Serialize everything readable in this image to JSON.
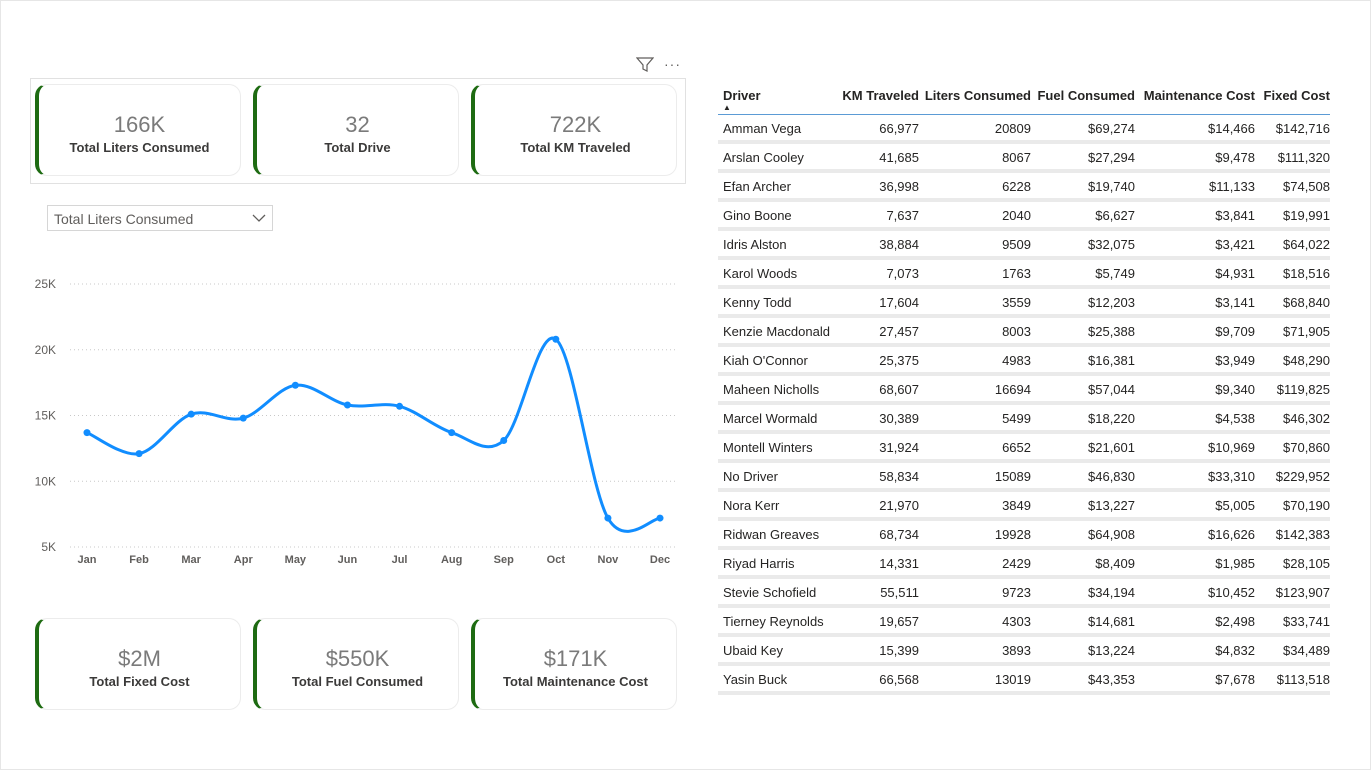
{
  "kpis_top": [
    {
      "value": "166K",
      "label": "Total Liters Consumed"
    },
    {
      "value": "32",
      "label": "Total Drive"
    },
    {
      "value": "722K",
      "label": "Total KM Traveled"
    }
  ],
  "kpis_bottom": [
    {
      "value": "$2M",
      "label": "Total Fixed Cost"
    },
    {
      "value": "$550K",
      "label": "Total Fuel Consumed"
    },
    {
      "value": "$171K",
      "label": "Total Maintenance Cost"
    }
  ],
  "visual_header": {
    "filter_icon": "filter-icon",
    "more_icon": "more-options-icon",
    "more_text": "···"
  },
  "dropdown": {
    "selected": "Total Liters Consumed",
    "icon": "chevron-down-icon"
  },
  "colors": {
    "accent": "#1e6b12",
    "line": "#118dff",
    "header_rule": "#5b9bd5"
  },
  "chart_data": {
    "type": "line",
    "categories": [
      "Jan",
      "Feb",
      "Mar",
      "Apr",
      "May",
      "Jun",
      "Jul",
      "Aug",
      "Sep",
      "Oct",
      "Nov",
      "Dec"
    ],
    "values": [
      13700,
      12100,
      15100,
      14800,
      17300,
      15800,
      15700,
      13700,
      13100,
      20800,
      7200,
      7200
    ],
    "y_ticks": [
      "5K",
      "10K",
      "15K",
      "20K",
      "25K"
    ],
    "y_tick_values": [
      5000,
      10000,
      15000,
      20000,
      25000
    ],
    "ylim": [
      5000,
      25000
    ],
    "grid": true,
    "legend": "none"
  },
  "table": {
    "columns": [
      "Driver",
      "KM Traveled",
      "Liters Consumed",
      "Fuel Consumed",
      "Maintenance Cost",
      "Fixed Cost"
    ],
    "sort": {
      "column": "Driver",
      "direction": "ascending"
    },
    "rows": [
      [
        "Amman Vega",
        "66,977",
        "20809",
        "$69,274",
        "$14,466",
        "$142,716"
      ],
      [
        "Arslan Cooley",
        "41,685",
        "8067",
        "$27,294",
        "$9,478",
        "$111,320"
      ],
      [
        "Efan Archer",
        "36,998",
        "6228",
        "$19,740",
        "$11,133",
        "$74,508"
      ],
      [
        "Gino Boone",
        "7,637",
        "2040",
        "$6,627",
        "$3,841",
        "$19,991"
      ],
      [
        "Idris Alston",
        "38,884",
        "9509",
        "$32,075",
        "$3,421",
        "$64,022"
      ],
      [
        "Karol Woods",
        "7,073",
        "1763",
        "$5,749",
        "$4,931",
        "$18,516"
      ],
      [
        "Kenny Todd",
        "17,604",
        "3559",
        "$12,203",
        "$3,141",
        "$68,840"
      ],
      [
        "Kenzie Macdonald",
        "27,457",
        "8003",
        "$25,388",
        "$9,709",
        "$71,905"
      ],
      [
        "Kiah O'Connor",
        "25,375",
        "4983",
        "$16,381",
        "$3,949",
        "$48,290"
      ],
      [
        "Maheen Nicholls",
        "68,607",
        "16694",
        "$57,044",
        "$9,340",
        "$119,825"
      ],
      [
        "Marcel Wormald",
        "30,389",
        "5499",
        "$18,220",
        "$4,538",
        "$46,302"
      ],
      [
        "Montell Winters",
        "31,924",
        "6652",
        "$21,601",
        "$10,969",
        "$70,860"
      ],
      [
        "No Driver",
        "58,834",
        "15089",
        "$46,830",
        "$33,310",
        "$229,952"
      ],
      [
        "Nora Kerr",
        "21,970",
        "3849",
        "$13,227",
        "$5,005",
        "$70,190"
      ],
      [
        "Ridwan Greaves",
        "68,734",
        "19928",
        "$64,908",
        "$16,626",
        "$142,383"
      ],
      [
        "Riyad Harris",
        "14,331",
        "2429",
        "$8,409",
        "$1,985",
        "$28,105"
      ],
      [
        "Stevie Schofield",
        "55,511",
        "9723",
        "$34,194",
        "$10,452",
        "$123,907"
      ],
      [
        "Tierney Reynolds",
        "19,657",
        "4303",
        "$14,681",
        "$2,498",
        "$33,741"
      ],
      [
        "Ubaid Key",
        "15,399",
        "3893",
        "$13,224",
        "$4,832",
        "$34,489"
      ],
      [
        "Yasin Buck",
        "66,568",
        "13019",
        "$43,353",
        "$7,678",
        "$113,518"
      ]
    ]
  }
}
